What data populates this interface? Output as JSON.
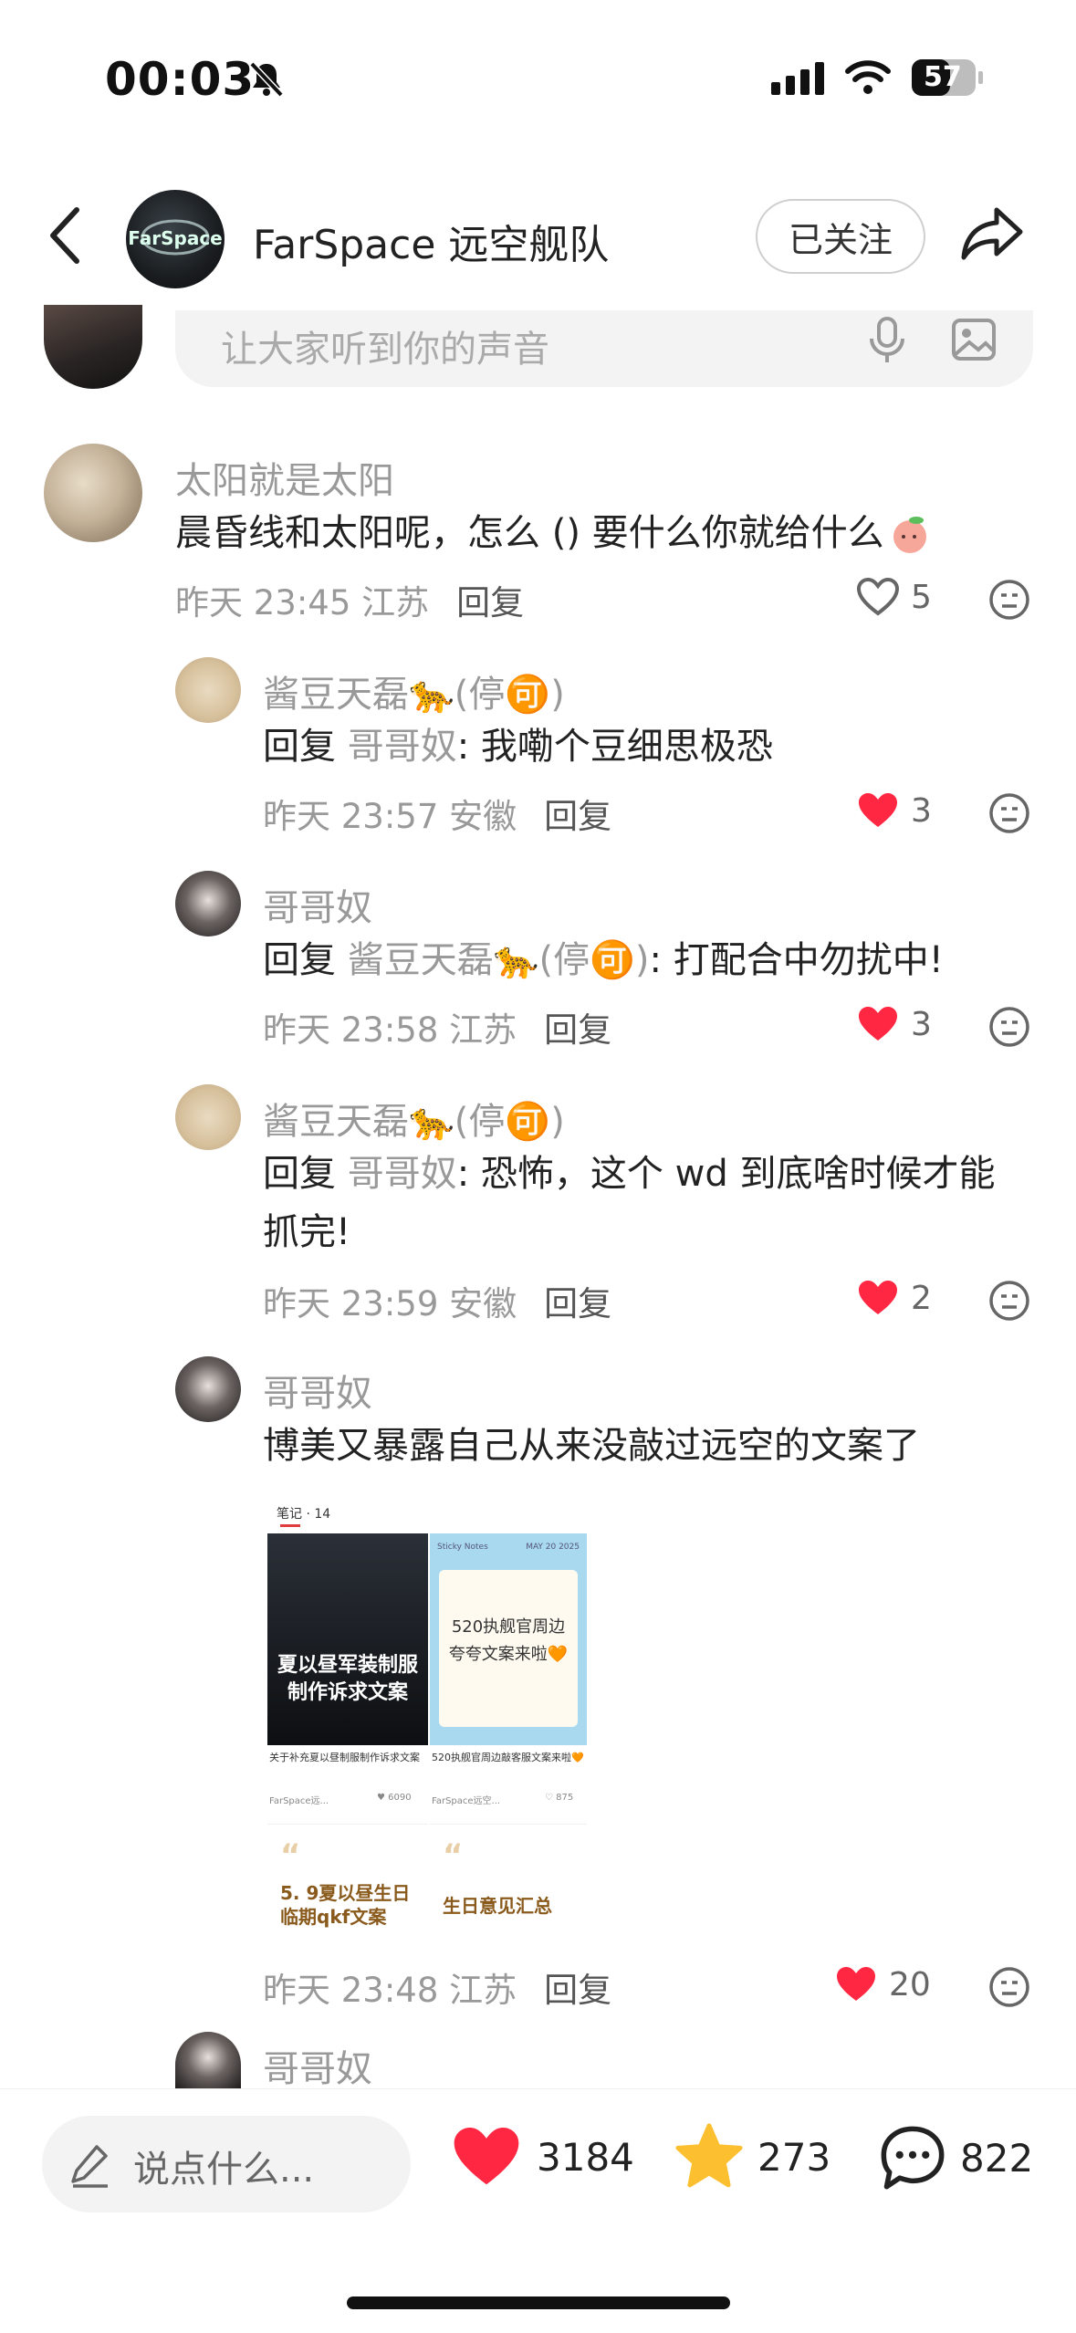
{
  "status_bar": {
    "time": "00:03",
    "battery": "57"
  },
  "header": {
    "title": "FarSpace 远空舰队",
    "follow_label": "已关注"
  },
  "comment_input": {
    "placeholder": "让大家听到你的声音"
  },
  "comments": [
    {
      "name": "太阳就是太阳",
      "text": "晨昏线和太阳呢，怎么 () 要什么你就给什么",
      "meta_time": "昨天 23:45 江苏",
      "reply_label": "回复",
      "likes": "5",
      "liked": false
    },
    {
      "name": "酱豆天磊🐆(停🉑)",
      "reply_word": "回复",
      "reply_to": "哥哥奴",
      "text": ": 我嘞个豆细思极恐",
      "meta_time": "昨天 23:57 安徽",
      "reply_label": "回复",
      "likes": "3",
      "liked": true
    },
    {
      "name": "哥哥奴",
      "reply_word": "回复",
      "reply_to": "酱豆天磊🐆(停🉑)",
      "text": ": 打配合中勿扰中!",
      "meta_time": "昨天 23:58 江苏",
      "reply_label": "回复",
      "likes": "3",
      "liked": true
    },
    {
      "name": "酱豆天磊🐆(停🉑)",
      "reply_word": "回复",
      "reply_to": "哥哥奴",
      "text": ": 恐怖，这个 wd 到底啥时候才能",
      "text2": "抓完!",
      "meta_time": "昨天 23:59 安徽",
      "reply_label": "回复",
      "likes": "2",
      "liked": true
    },
    {
      "name": "哥哥奴",
      "text": "博美又暴露自己从来没敲过远空的文案了",
      "meta_time": "昨天 23:48 江苏",
      "reply_label": "回复",
      "likes": "20",
      "liked": true
    },
    {
      "name": "哥哥奴"
    }
  ],
  "notes_image": {
    "tab": "笔记 · 14",
    "card1_title": "夏以昼军装制服制作诉求文案",
    "card1_caption": "关于补充夏以昼制服制作诉求文案",
    "card1_author": "FarSpace远...",
    "card1_likes": "6090",
    "card2_header_left": "Sticky Notes",
    "card2_header_right": "MAY 20 2025",
    "card2_text": "520执舰官周边夸夸文案来啦🧡",
    "card2_caption": "520执舰官周边敲客服文案来啦🧡",
    "card2_author": "FarSpace远空...",
    "card2_likes": "875",
    "card3_text": "5. 9夏以昼生日临期qkf文案",
    "card4_text": "生日意见汇总"
  },
  "bottom_bar": {
    "placeholder": "说点什么...",
    "likes": "3184",
    "favorites": "273",
    "comments": "822"
  },
  "colors": {
    "like_red": "#ff2741",
    "star_yellow": "#fcbf2f"
  }
}
